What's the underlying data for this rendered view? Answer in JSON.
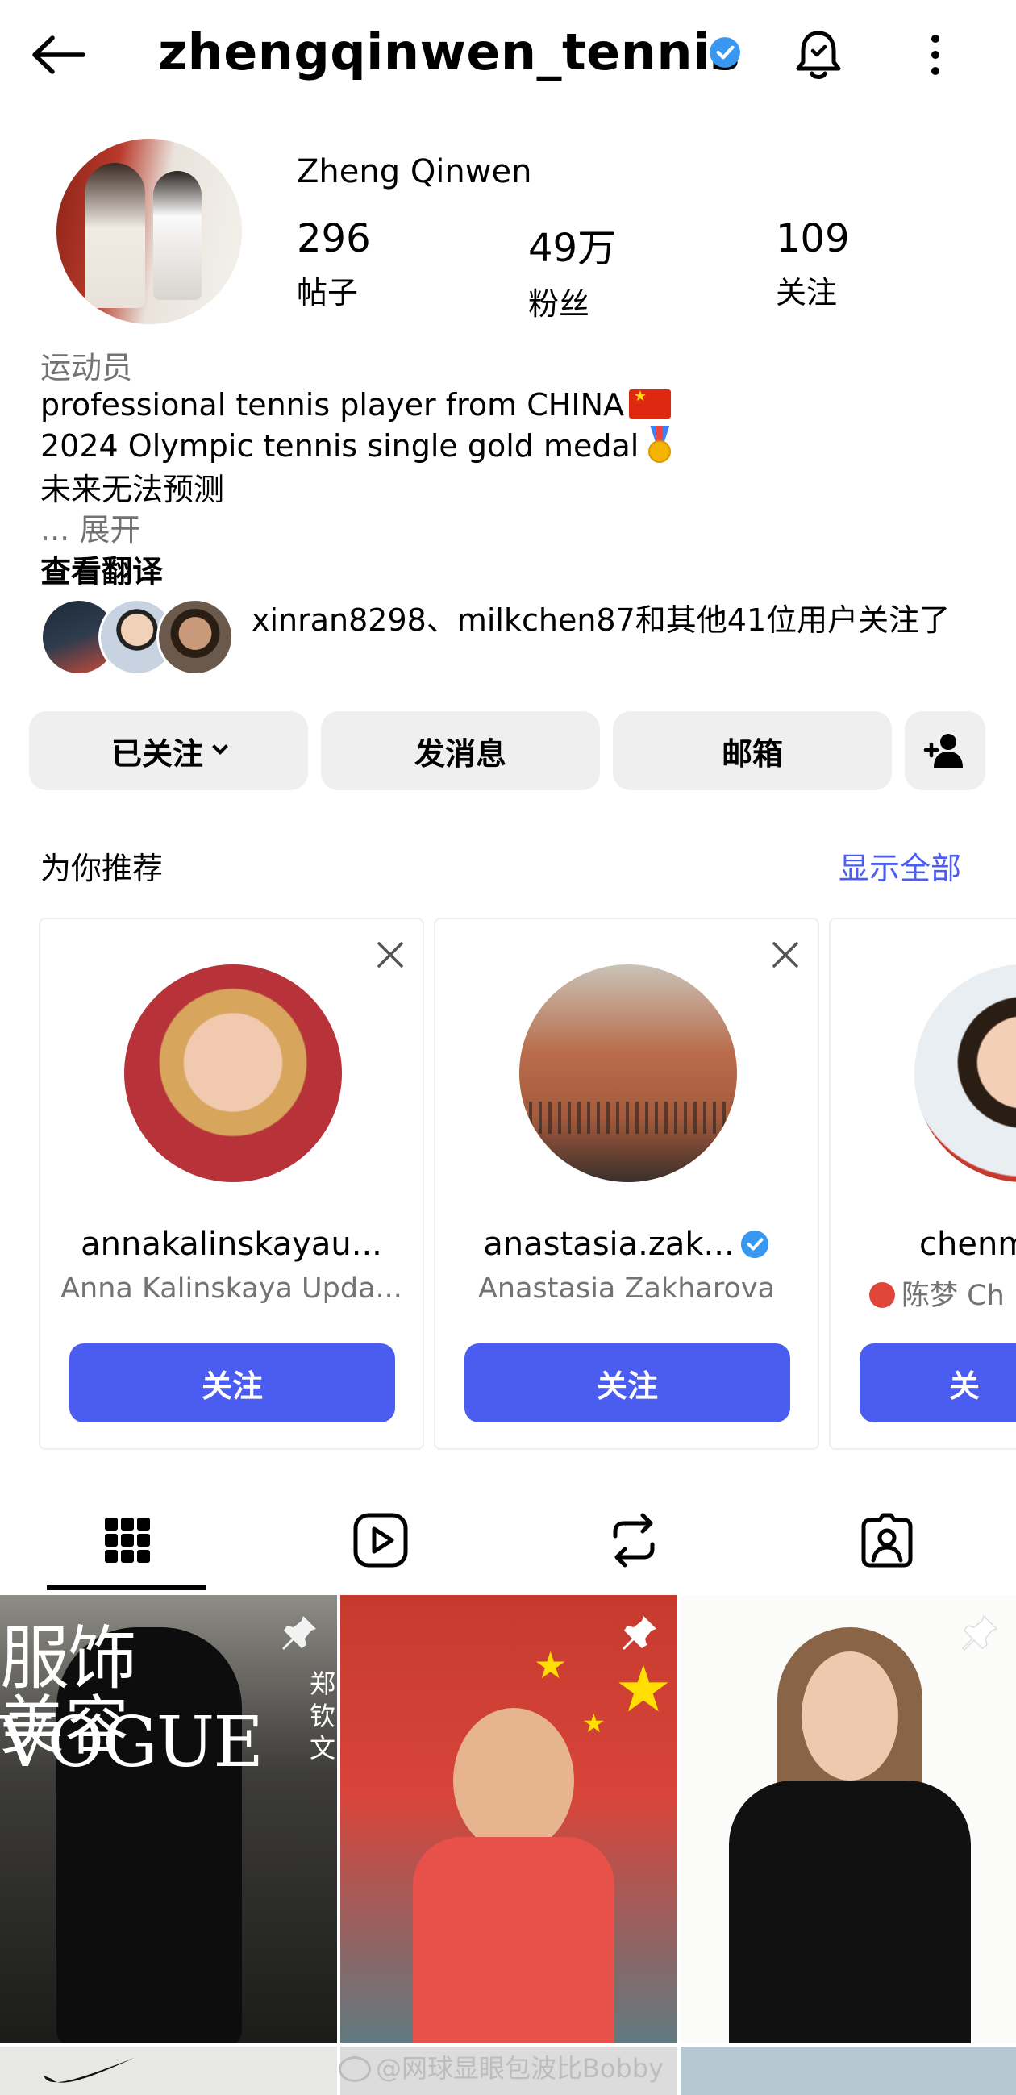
{
  "header": {
    "username": "zhengqinwen_tennis",
    "verified": true,
    "icons": {
      "back": "back-arrow-icon",
      "notifications": "bell-icon",
      "more": "more-vertical-icon"
    }
  },
  "profile": {
    "full_name": "Zheng Qinwen",
    "stats": {
      "posts": {
        "value": "296",
        "label": "帖子"
      },
      "followers": {
        "value": "49万",
        "label": "粉丝"
      },
      "following": {
        "value": "109",
        "label": "关注"
      }
    },
    "category": "运动员",
    "bio": [
      "professional tennis player from CHINA",
      "2024 Olympic tennis single gold medal",
      "未来无法预测"
    ],
    "expand_label": "... 展开",
    "translate_label": "查看翻译",
    "mutual_followers": "xinran8298、milkchen87和其他41位用户关注了"
  },
  "actions": {
    "following": "已关注",
    "message": "发消息",
    "email": "邮箱"
  },
  "suggestions": {
    "title": "为你推荐",
    "show_all": "显示全部",
    "items": [
      {
        "username": "annakalinskayau...",
        "display_name": "Anna Kalinskaya Upda...",
        "verified": false,
        "follow_label": "关注"
      },
      {
        "username": "anastasia.zak...",
        "display_name": "Anastasia Zakharova",
        "verified": true,
        "follow_label": "关注"
      },
      {
        "username": "chenm",
        "display_name": "陈梦 Ch",
        "verified": false,
        "follow_label": "关"
      }
    ]
  },
  "tabs": [
    {
      "name": "posts",
      "icon": "grid-icon",
      "active": true
    },
    {
      "name": "reels",
      "icon": "reels-play-icon",
      "active": false
    },
    {
      "name": "reposts",
      "icon": "repost-icon",
      "active": false
    },
    {
      "name": "tagged",
      "icon": "tagged-person-icon",
      "active": false
    }
  ],
  "grid": {
    "post1": {
      "cover_title": "VOGUE",
      "cover_sub1": "服饰",
      "cover_sub2": "美容",
      "side_text": "郑钦文",
      "pinned": true
    },
    "post2": {
      "pinned": true
    },
    "post3": {
      "pinned": true
    }
  },
  "watermark": "@网球显眼包波比Bobby",
  "colors": {
    "accent": "#4a5df0",
    "button_bg": "#efefef",
    "muted_text": "#737373",
    "verified": "#3897f0"
  }
}
